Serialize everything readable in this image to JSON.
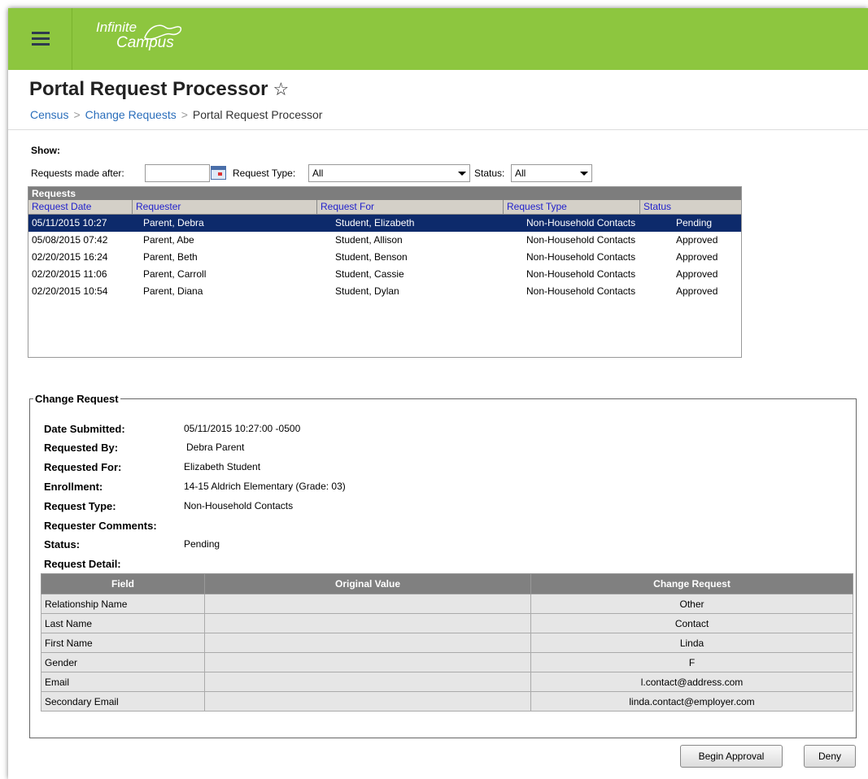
{
  "header": {
    "brand_line1": "Infinite",
    "brand_line2": "Campus",
    "accent": "#8dc63f"
  },
  "page": {
    "title": "Portal Request Processor",
    "breadcrumb": [
      "Census",
      "Change Requests",
      "Portal Request Processor"
    ]
  },
  "filters": {
    "show_label": "Show:",
    "date_label": "Requests made after:",
    "date_value": "",
    "type_label": "Request Type:",
    "type_value": "All",
    "status_label": "Status:",
    "status_value": "All"
  },
  "requests": {
    "title": "Requests",
    "columns": [
      "Request Date",
      "Requester",
      "Request For",
      "Request Type",
      "Status"
    ],
    "rows": [
      {
        "date": "05/11/2015 10:27",
        "requester": "Parent, Debra",
        "for": "Student, Elizabeth",
        "type": "Non-Household Contacts",
        "status": "Pending"
      },
      {
        "date": "05/08/2015 07:42",
        "requester": "Parent, Abe",
        "for": "Student, Allison",
        "type": "Non-Household Contacts",
        "status": "Approved"
      },
      {
        "date": "02/20/2015 16:24",
        "requester": "Parent, Beth",
        "for": "Student, Benson",
        "type": "Non-Household Contacts",
        "status": "Approved"
      },
      {
        "date": "02/20/2015 11:06",
        "requester": "Parent, Carroll",
        "for": "Student, Cassie",
        "type": "Non-Household Contacts",
        "status": "Approved"
      },
      {
        "date": "02/20/2015 10:54",
        "requester": "Parent, Diana",
        "for": "Student, Dylan",
        "type": "Non-Household Contacts",
        "status": "Approved"
      }
    ]
  },
  "change_request": {
    "legend": "Change Request",
    "fields": [
      {
        "label": "Date Submitted:",
        "value": "05/11/2015 10:27:00 -0500"
      },
      {
        "label": "Requested By:",
        "value": "Debra Parent"
      },
      {
        "label": "Requested For:",
        "value": "Elizabeth Student"
      },
      {
        "label": "Enrollment:",
        "value": "14-15 Aldrich Elementary (Grade: 03)"
      },
      {
        "label": "Request Type:",
        "value": "Non-Household Contacts"
      },
      {
        "label": "Requester Comments:",
        "value": ""
      },
      {
        "label": "Status:",
        "value": "Pending"
      },
      {
        "label": "Request Detail:",
        "value": ""
      }
    ],
    "detail_columns": [
      "Field",
      "Original Value",
      "Change Request"
    ],
    "detail_rows": [
      {
        "field": "Relationship Name",
        "original": "",
        "change": "Other"
      },
      {
        "field": "Last Name",
        "original": "",
        "change": "Contact"
      },
      {
        "field": "First Name",
        "original": "",
        "change": "Linda"
      },
      {
        "field": "Gender",
        "original": "",
        "change": "F"
      },
      {
        "field": "Email",
        "original": "",
        "change": "l.contact@address.com"
      },
      {
        "field": "Secondary Email",
        "original": "",
        "change": "linda.contact@employer.com"
      }
    ]
  },
  "actions": {
    "begin_approval": "Begin Approval",
    "deny": "Deny"
  }
}
